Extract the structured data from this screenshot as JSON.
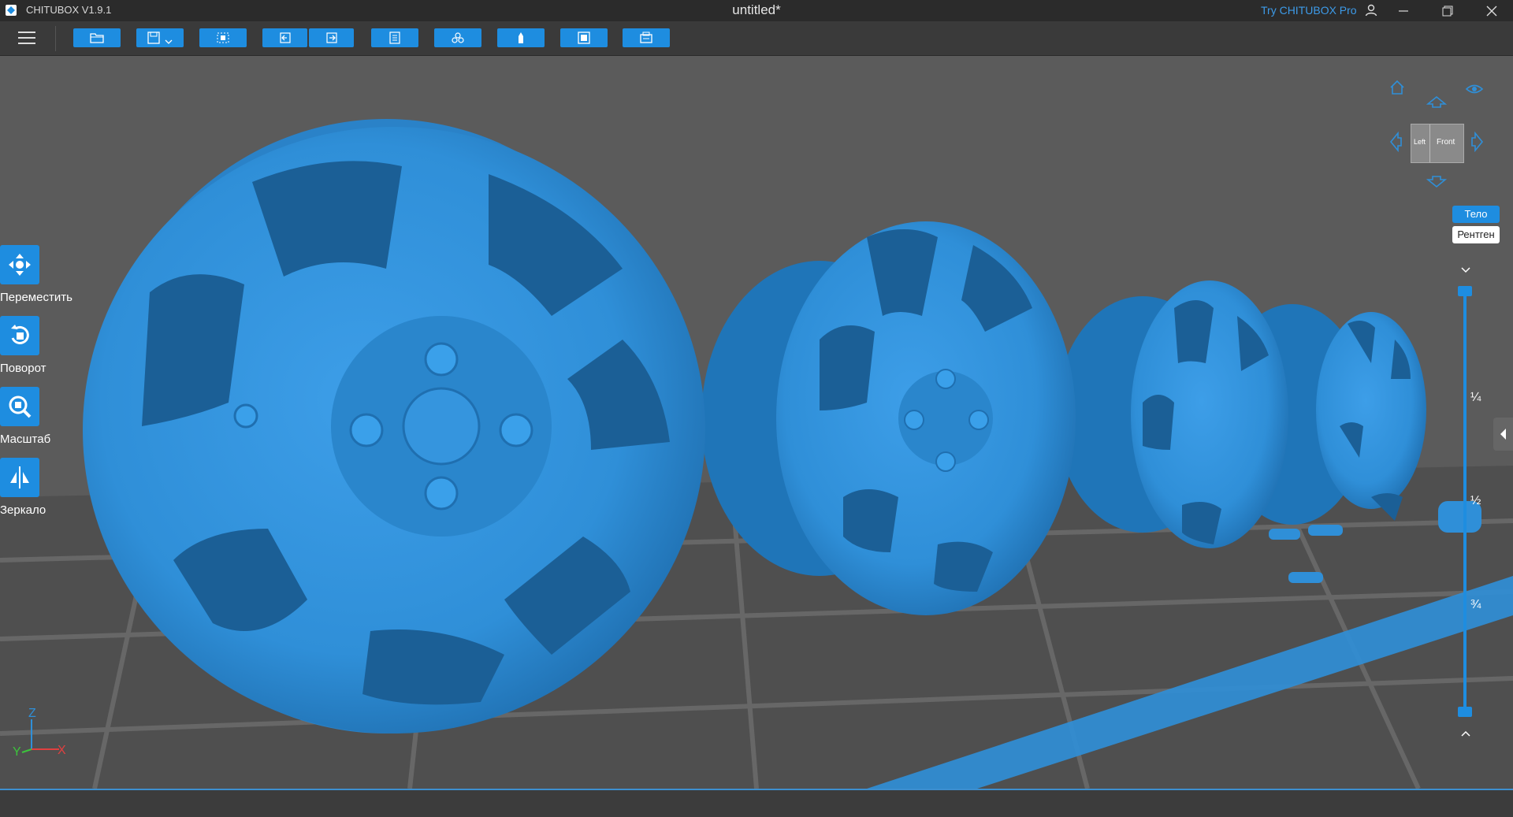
{
  "titlebar": {
    "app_name": "CHITUBOX V1.9.1",
    "document_title": "untitled*",
    "try_pro": "Try CHITUBOX Pro"
  },
  "toolbar": {
    "buttons": [
      {
        "name": "open-file-button",
        "icon": "folder-open-icon"
      },
      {
        "name": "save-file-button",
        "icon": "save-icon",
        "has_dropdown": true
      },
      {
        "name": "select-all-button",
        "icon": "select-all-icon"
      },
      {
        "name": "undo-button",
        "icon": "undo-icon"
      },
      {
        "name": "redo-button",
        "icon": "redo-icon"
      },
      {
        "name": "settings-button",
        "icon": "settings-icon"
      },
      {
        "name": "supports-button",
        "icon": "supports-icon"
      },
      {
        "name": "hollow-button",
        "icon": "hollow-icon"
      },
      {
        "name": "slice-button",
        "icon": "slice-icon"
      },
      {
        "name": "printer-button",
        "icon": "printer-icon"
      }
    ]
  },
  "tools": [
    {
      "name": "move-tool",
      "label": "Переместить",
      "icon": "move-icon"
    },
    {
      "name": "rotate-tool",
      "label": "Поворот",
      "icon": "rotate-icon"
    },
    {
      "name": "scale-tool",
      "label": "Масштаб",
      "icon": "scale-icon"
    },
    {
      "name": "mirror-tool",
      "label": "Зеркало",
      "icon": "mirror-icon"
    }
  ],
  "view_cube": {
    "left_label": "Left",
    "front_label": "Front"
  },
  "view_modes": {
    "solid": "Тело",
    "xray": "Рентген"
  },
  "layer_slider": {
    "marks": [
      "¼",
      "½",
      "¾"
    ]
  },
  "axes": {
    "x": "X",
    "y": "Y",
    "z": "Z"
  },
  "colors": {
    "accent": "#1e8de0",
    "model": "#2f8fd8",
    "try_pro": "#3d9be9"
  }
}
